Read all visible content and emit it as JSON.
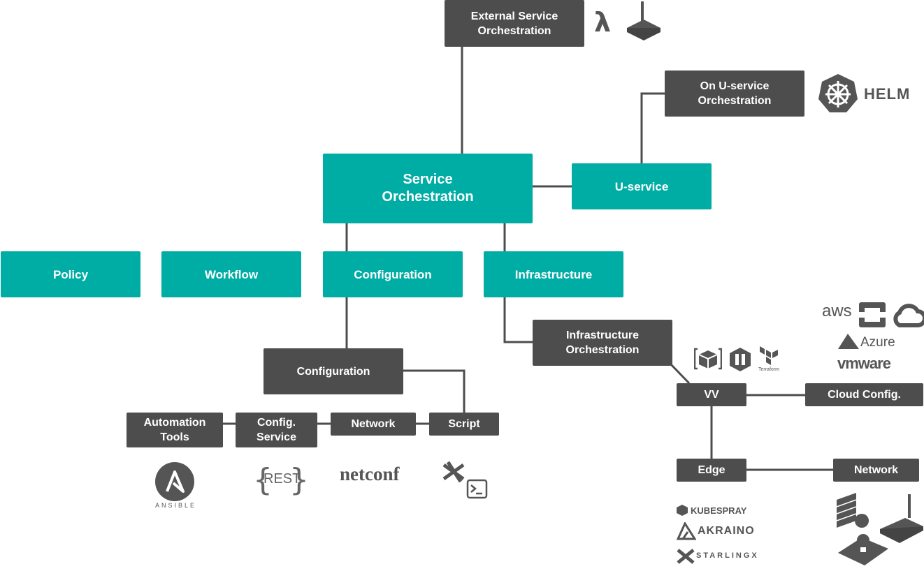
{
  "nodes": {
    "external_service_orchestration": "External Service\nOrchestration",
    "on_uservice_orchestration": "On U-service\nOrchestration",
    "service_orchestration": "Service\nOrchestration",
    "uservice": "U-service",
    "policy": "Policy",
    "workflow": "Workflow",
    "configuration": "Configuration",
    "infrastructure": "Infrastructure",
    "configuration_sub": "Configuration",
    "infrastructure_orchestration": "Infrastructure\nOrchestration",
    "automation_tools": "Automation\nTools",
    "config_service": "Config.\nService",
    "network": "Network",
    "script": "Script",
    "vv": "VV",
    "cloud_config": "Cloud Config.",
    "edge": "Edge",
    "network_edge": "Network"
  },
  "logos": {
    "lambda": "λ",
    "helm": "HELM",
    "aws": "aws",
    "azure": "Azure",
    "vmware": "vmware",
    "terraform": "Terraform",
    "ansible": "ANSIBLE",
    "rest": "REST",
    "netconf": "netconf",
    "kubespray": "KUBESPRAY",
    "akraino": "AKRAINO",
    "starlingx": "STARLINGX"
  },
  "colors": {
    "teal": "#00ada5",
    "dark": "#4d4d4d",
    "line": "#4d4d4d"
  }
}
